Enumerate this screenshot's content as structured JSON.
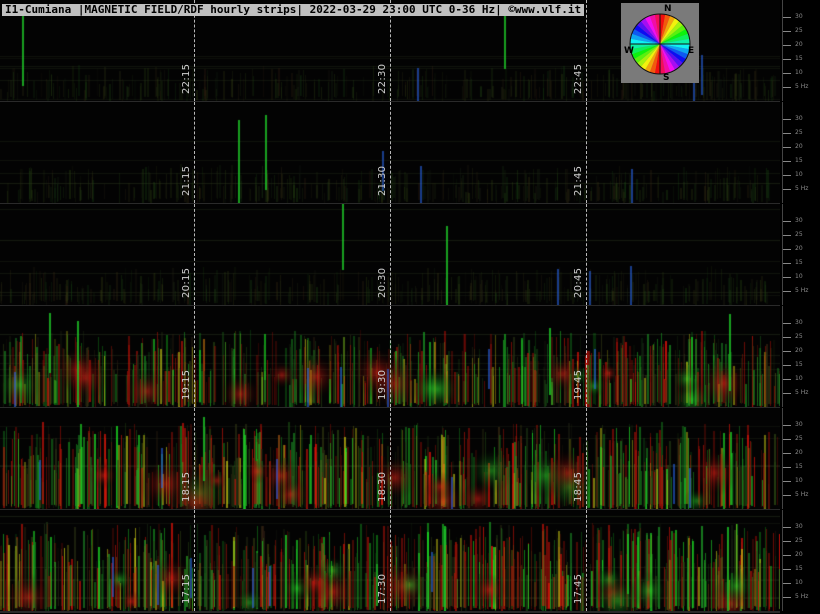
{
  "header": {
    "title": "I1-Cumiana |MAGNETIC FIELD/RDF hourly strips| 2022-03-29 23:00 UTC 0-36 Hz| ©www.vlf.it"
  },
  "compass": {
    "north": "N",
    "east": "E",
    "south": "S",
    "west": "W",
    "icon": "direction-color-wheel-icon"
  },
  "scale": {
    "ticks": [
      "30",
      "25",
      "20",
      "15",
      "10",
      "5 Hz"
    ]
  },
  "strips": [
    {
      "hour": "22",
      "times": [
        "22:15",
        "22:30",
        "22:45"
      ],
      "activity": 0.1
    },
    {
      "hour": "21",
      "times": [
        "21:15",
        "21:30",
        "21:45"
      ],
      "activity": 0.15
    },
    {
      "hour": "20",
      "times": [
        "20:15",
        "20:30",
        "20:45"
      ],
      "activity": 0.15
    },
    {
      "hour": "19",
      "times": [
        "19:15",
        "19:30",
        "19:45"
      ],
      "activity": 0.8
    },
    {
      "hour": "18",
      "times": [
        "18:15",
        "18:30",
        "18:45"
      ],
      "activity": 0.95
    },
    {
      "hour": "17",
      "times": [
        "17:15",
        "17:30",
        "17:45"
      ],
      "activity": 1.0
    }
  ],
  "colors": {
    "header_bg": "#c0c0c0",
    "compass_bg": "#7a7a7a",
    "grid": "#d8d8d8"
  }
}
